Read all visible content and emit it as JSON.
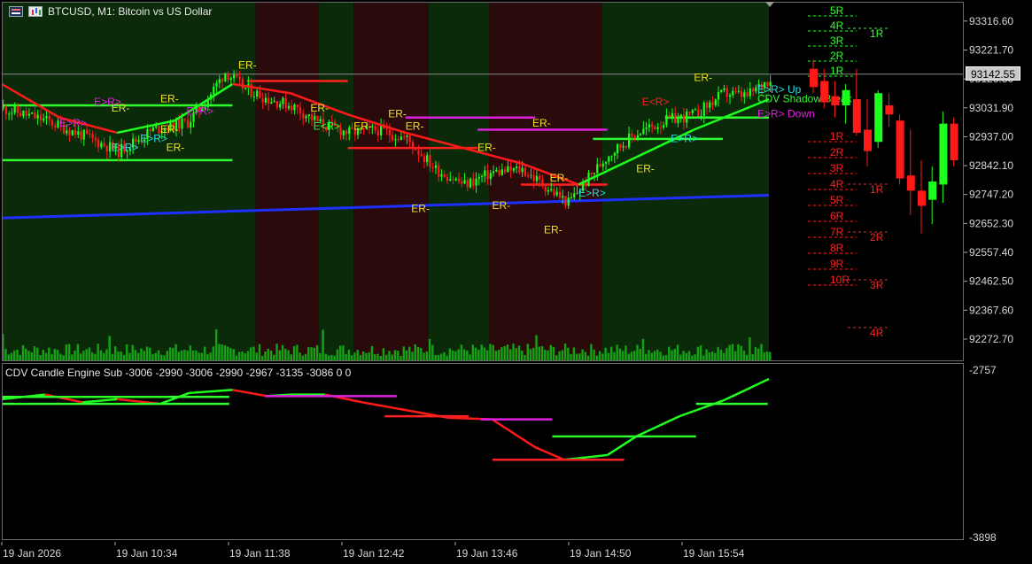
{
  "header": {
    "title": "BTCUSD, M1:  Bitcoin vs US Dollar",
    "menu_icon": "window-menu-icon",
    "chart_icon": "chart-type-icon"
  },
  "subwindow": {
    "title": "CDV Candle Engine Sub -3006 -2990 -3006 -2990 -2967 -3135 -3086 0 0",
    "top_value": "-2757",
    "bottom_value": "-3898"
  },
  "price_axis": {
    "ticks": [
      "93316.60",
      "93221.70",
      "93126.80",
      "93031.90",
      "92937.00",
      "92842.10",
      "92747.20",
      "92652.30",
      "92557.40",
      "92462.50",
      "92367.60",
      "92272.70"
    ],
    "current_price": "93142.55"
  },
  "time_axis": {
    "ticks": [
      "19 Jan 2026",
      "19 Jan 10:34",
      "19 Jan 11:38",
      "19 Jan 12:42",
      "19 Jan 13:46",
      "19 Jan 14:50",
      "19 Jan 15:54"
    ]
  },
  "colors": {
    "background": "#000000",
    "bull_session": "#0a2a0a",
    "bear_session": "#2a0a0a",
    "bull_candle": "#1cff1c",
    "bear_candle": "#ff1a1a",
    "trend_line": "#1f2fff",
    "volume": "#16a016",
    "level_green": "#2cff2c",
    "level_red": "#ff2020",
    "level_magenta": "#e020e0",
    "label_yellow": "#f0e020",
    "label_cyan": "#20e0e0"
  },
  "chart_data": {
    "type": "candlestick",
    "title": "BTCUSD, M1:  Bitcoin vs US Dollar",
    "ylim": [
      92200,
      93380
    ],
    "y_ticks": [
      93316.6,
      93221.7,
      93126.8,
      93031.9,
      92937.0,
      92842.1,
      92747.2,
      92652.3,
      92557.4,
      92462.5,
      92367.6,
      92272.7
    ],
    "current_price": 93142.55,
    "x_ticks": [
      "19 Jan 2026",
      "19 Jan 10:34",
      "19 Jan 11:38",
      "19 Jan 12:42",
      "19 Jan 13:46",
      "19 Jan 14:50",
      "19 Jan 15:54"
    ],
    "close_path": [
      {
        "t": 0,
        "p": 93030
      },
      {
        "t": 15,
        "p": 92990
      },
      {
        "t": 28,
        "p": 92940
      },
      {
        "t": 40,
        "p": 92890
      },
      {
        "t": 52,
        "p": 92960
      },
      {
        "t": 64,
        "p": 92985
      },
      {
        "t": 70,
        "p": 93050
      },
      {
        "t": 77,
        "p": 93150
      },
      {
        "t": 83,
        "p": 93100
      },
      {
        "t": 92,
        "p": 93060
      },
      {
        "t": 100,
        "p": 93040
      },
      {
        "t": 110,
        "p": 92980
      },
      {
        "t": 120,
        "p": 92950
      },
      {
        "t": 130,
        "p": 92960
      },
      {
        "t": 140,
        "p": 92930
      },
      {
        "t": 150,
        "p": 92830
      },
      {
        "t": 160,
        "p": 92780
      },
      {
        "t": 170,
        "p": 92820
      },
      {
        "t": 180,
        "p": 92830
      },
      {
        "t": 190,
        "p": 92760
      },
      {
        "t": 196,
        "p": 92720
      },
      {
        "t": 202,
        "p": 92790
      },
      {
        "t": 210,
        "p": 92880
      },
      {
        "t": 220,
        "p": 92950
      },
      {
        "t": 230,
        "p": 92990
      },
      {
        "t": 240,
        "p": 93010
      },
      {
        "t": 250,
        "p": 93080
      },
      {
        "t": 258,
        "p": 93070
      },
      {
        "t": 266,
        "p": 93130
      }
    ],
    "ma_line": [
      {
        "t": 0,
        "p": 93110
      },
      {
        "t": 20,
        "p": 93000
      },
      {
        "t": 40,
        "p": 92950
      },
      {
        "t": 60,
        "p": 92990
      },
      {
        "t": 80,
        "p": 93110
      },
      {
        "t": 100,
        "p": 93080
      },
      {
        "t": 120,
        "p": 93010
      },
      {
        "t": 140,
        "p": 92950
      },
      {
        "t": 160,
        "p": 92900
      },
      {
        "t": 180,
        "p": 92850
      },
      {
        "t": 200,
        "p": 92780
      },
      {
        "t": 220,
        "p": 92870
      },
      {
        "t": 240,
        "p": 92960
      },
      {
        "t": 266,
        "p": 93060
      }
    ],
    "trend_line": {
      "t0": 0,
      "p0": 92670,
      "t1": 266,
      "p1": 92745
    },
    "sessions": [
      {
        "from": 0,
        "to": 88,
        "kind": "bull"
      },
      {
        "from": 88,
        "to": 110,
        "kind": "bear"
      },
      {
        "from": 110,
        "to": 122,
        "kind": "bull"
      },
      {
        "from": 122,
        "to": 148,
        "kind": "bear"
      },
      {
        "from": 148,
        "to": 169,
        "kind": "bull"
      },
      {
        "from": 169,
        "to": 208,
        "kind": "bear"
      },
      {
        "from": 208,
        "to": 266,
        "kind": "bull"
      }
    ],
    "levels": [
      {
        "t0": 0,
        "t1": 80,
        "p": 93040,
        "color": "green"
      },
      {
        "t0": 0,
        "t1": 80,
        "p": 92860,
        "color": "green"
      },
      {
        "t0": 85,
        "t1": 120,
        "p": 93120,
        "color": "red"
      },
      {
        "t0": 120,
        "t1": 165,
        "p": 92900,
        "color": "red"
      },
      {
        "t0": 140,
        "t1": 185,
        "p": 93000,
        "color": "magenta"
      },
      {
        "t0": 165,
        "t1": 210,
        "p": 92960,
        "color": "magenta"
      },
      {
        "t0": 180,
        "t1": 210,
        "p": 92780,
        "color": "red"
      },
      {
        "t0": 205,
        "t1": 250,
        "p": 92930,
        "color": "green"
      },
      {
        "t0": 230,
        "t1": 266,
        "p": 93000,
        "color": "green"
      }
    ],
    "markers": [
      {
        "t": 38,
        "p": 93020,
        "text": "ER-",
        "color": "yellow"
      },
      {
        "t": 55,
        "p": 93050,
        "text": "ER-",
        "color": "yellow"
      },
      {
        "t": 55,
        "p": 92950,
        "text": "ER-",
        "color": "yellow"
      },
      {
        "t": 57,
        "p": 92890,
        "text": "ER-",
        "color": "yellow"
      },
      {
        "t": 82,
        "p": 93160,
        "text": "ER-",
        "color": "yellow"
      },
      {
        "t": 107,
        "p": 93020,
        "text": "ER-",
        "color": "yellow"
      },
      {
        "t": 122,
        "p": 92960,
        "text": "ER-",
        "color": "yellow"
      },
      {
        "t": 134,
        "p": 93000,
        "text": "ER-",
        "color": "yellow"
      },
      {
        "t": 140,
        "p": 92960,
        "text": "ER-",
        "color": "yellow"
      },
      {
        "t": 142,
        "p": 92690,
        "text": "ER-",
        "color": "yellow"
      },
      {
        "t": 165,
        "p": 92890,
        "text": "ER-",
        "color": "yellow"
      },
      {
        "t": 170,
        "p": 92700,
        "text": "ER-",
        "color": "yellow"
      },
      {
        "t": 184,
        "p": 92970,
        "text": "ER-",
        "color": "yellow"
      },
      {
        "t": 190,
        "p": 92790,
        "text": "ER-",
        "color": "yellow"
      },
      {
        "t": 188,
        "p": 92620,
        "text": "ER-",
        "color": "yellow"
      },
      {
        "t": 220,
        "p": 92820,
        "text": "ER-",
        "color": "yellow"
      },
      {
        "t": 240,
        "p": 93120,
        "text": "ER-",
        "color": "yellow"
      },
      {
        "t": 32,
        "p": 93040,
        "text": "E>R>",
        "color": "magenta"
      },
      {
        "t": 20,
        "p": 92970,
        "text": "E>R>",
        "color": "magenta"
      },
      {
        "t": 64,
        "p": 93010,
        "text": "E>R>",
        "color": "magenta"
      },
      {
        "t": 38,
        "p": 92890,
        "text": "E>R>",
        "color": "cyan"
      },
      {
        "t": 48,
        "p": 92920,
        "text": "E>R>",
        "color": "cyan"
      },
      {
        "t": 108,
        "p": 92960,
        "text": "E<R>",
        "color": "green"
      },
      {
        "t": 200,
        "p": 92740,
        "text": "E>R>",
        "color": "cyan"
      },
      {
        "t": 232,
        "p": 92920,
        "text": "E>R>",
        "color": "cyan"
      },
      {
        "t": 222,
        "p": 93040,
        "text": "E<R>",
        "color": "red"
      },
      {
        "t": 262,
        "p": 93080,
        "text": "E>R> Up",
        "color": "cyan"
      },
      {
        "t": 262,
        "p": 93000,
        "text": "E>R> Down",
        "color": "magenta"
      },
      {
        "t": 262,
        "p": 93050,
        "text": "CDV Shadow Break",
        "color": "green"
      }
    ],
    "r_levels_up": [
      "5R",
      "4R",
      "3R",
      "2R",
      "1R"
    ],
    "r_levels_down": [
      "1R",
      "2R",
      "3R",
      "4R",
      "5R",
      "6R",
      "7R",
      "8R",
      "9R",
      "10R"
    ],
    "r_levels_right": [
      "1R",
      "1R",
      "2R",
      "3R",
      "4R"
    ],
    "future_candles": [
      {
        "o": 93160,
        "h": 93190,
        "l": 93080,
        "c": 93100
      },
      {
        "o": 93120,
        "h": 93160,
        "l": 93030,
        "c": 93050
      },
      {
        "o": 93070,
        "h": 93120,
        "l": 93000,
        "c": 93040
      },
      {
        "o": 93040,
        "h": 93110,
        "l": 92980,
        "c": 93090
      },
      {
        "o": 93060,
        "h": 93160,
        "l": 92940,
        "c": 92950
      },
      {
        "o": 92960,
        "h": 93060,
        "l": 92840,
        "c": 92890
      },
      {
        "o": 92920,
        "h": 93090,
        "l": 92900,
        "c": 93080
      },
      {
        "o": 93040,
        "h": 93080,
        "l": 92970,
        "c": 93010
      },
      {
        "o": 92990,
        "h": 93010,
        "l": 92780,
        "c": 92800
      },
      {
        "o": 92810,
        "h": 92960,
        "l": 92680,
        "c": 92760
      },
      {
        "o": 92760,
        "h": 92860,
        "l": 92620,
        "c": 92710
      },
      {
        "o": 92730,
        "h": 92840,
        "l": 92650,
        "c": 92790
      },
      {
        "o": 92780,
        "h": 93020,
        "l": 92720,
        "c": 92980
      },
      {
        "o": 92980,
        "h": 93000,
        "l": 92840,
        "c": 92860
      }
    ],
    "sub_cdv_path": [
      {
        "t": 0,
        "v": -2990
      },
      {
        "t": 15,
        "v": -2960
      },
      {
        "t": 28,
        "v": -3010
      },
      {
        "t": 40,
        "v": -2990
      },
      {
        "t": 55,
        "v": -3020
      },
      {
        "t": 65,
        "v": -2950
      },
      {
        "t": 80,
        "v": -2930
      },
      {
        "t": 92,
        "v": -2970
      },
      {
        "t": 100,
        "v": -2960
      },
      {
        "t": 112,
        "v": -2960
      },
      {
        "t": 125,
        "v": -3010
      },
      {
        "t": 140,
        "v": -3060
      },
      {
        "t": 155,
        "v": -3110
      },
      {
        "t": 170,
        "v": -3120
      },
      {
        "t": 185,
        "v": -3300
      },
      {
        "t": 195,
        "v": -3380
      },
      {
        "t": 210,
        "v": -3350
      },
      {
        "t": 220,
        "v": -3230
      },
      {
        "t": 235,
        "v": -3100
      },
      {
        "t": 250,
        "v": -3000
      },
      {
        "t": 258,
        "v": -2930
      },
      {
        "t": 266,
        "v": -2860
      }
    ],
    "sub_ylim": [
      -3898,
      -2757
    ]
  }
}
